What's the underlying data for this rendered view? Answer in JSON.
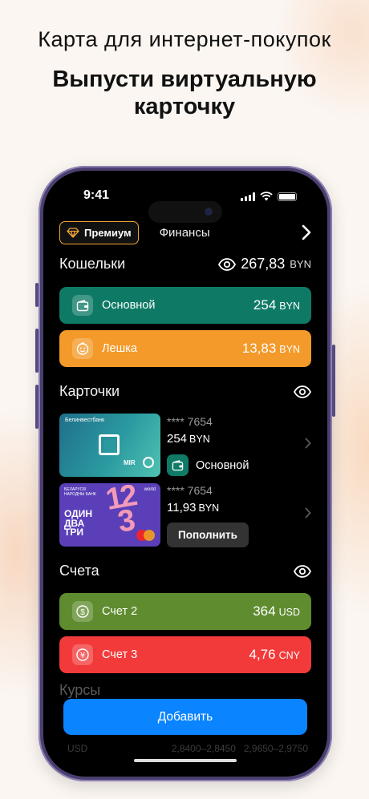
{
  "headline": "Карта для интернет-покупок",
  "subhead_line1": "Выпусти виртуальную",
  "subhead_line2": "карточку",
  "status": {
    "time": "9:41"
  },
  "topbar": {
    "premium_label": "Премиум",
    "finance_label": "Финансы"
  },
  "wallets": {
    "title": "Кошельки",
    "total_value": "267,83",
    "total_currency": "BYN",
    "items": [
      {
        "name": "Основной",
        "amount": "254",
        "currency": "BYN",
        "color": "#0e7a66",
        "icon": "wallet-icon"
      },
      {
        "name": "Лешка",
        "amount": "13,83",
        "currency": "BYN",
        "color": "#f39a2a",
        "icon": "smile-face-icon"
      }
    ]
  },
  "cards": {
    "title": "Карточки",
    "items": [
      {
        "bank": "Белинвестбанк",
        "brand": "MIR",
        "masked": "**** 7654",
        "amount": "254",
        "currency": "BYN",
        "wallet_name": "Основной"
      },
      {
        "bank": "БЕЛАРУСКІ НАРОДНЫ БАНК",
        "brand": "world",
        "art_text1": "ОДИН",
        "art_text2": "ДВА",
        "art_text3": "ТРИ",
        "masked": "**** 7654",
        "amount": "11,93",
        "currency": "BYN",
        "action": "Пополнить"
      }
    ]
  },
  "accounts": {
    "title": "Счета",
    "items": [
      {
        "name": "Счет 2",
        "amount": "364",
        "currency": "USD",
        "color": "#5f8c2f",
        "icon": "dollar-coin-icon"
      },
      {
        "name": "Счет 3",
        "amount": "4,76",
        "currency": "CNY",
        "color": "#f23a3a",
        "icon": "yuan-coin-icon"
      }
    ]
  },
  "rates": {
    "title": "Курсы",
    "currency": "USD",
    "buy": "2,8400–2,8450",
    "sell": "2,9650–2,9750"
  },
  "add_button": "Добавить",
  "colors": {
    "accent": "#0a84ff",
    "premium_border": "#f0a43a",
    "phone_frame": "#4a3f6e"
  }
}
